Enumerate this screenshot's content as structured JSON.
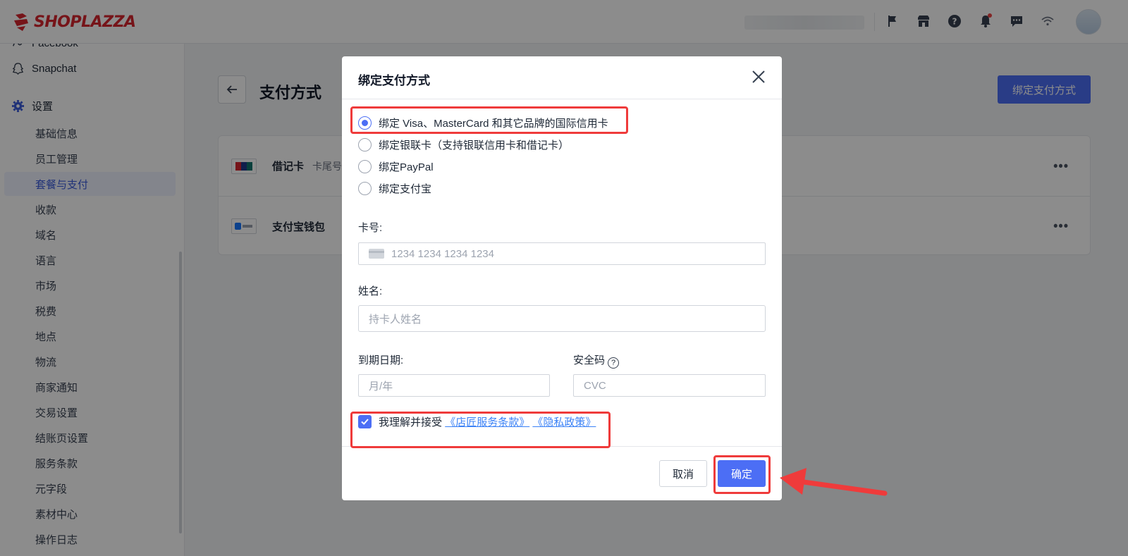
{
  "brand": {
    "name": "SHOPLAZZA",
    "color": "#d8262f"
  },
  "topbar": {
    "icons": [
      "flag-icon",
      "store-icon",
      "help-icon",
      "bell-icon",
      "chat-icon",
      "wifi-icon"
    ]
  },
  "sidebar": {
    "top_items": [
      {
        "label": "Facebook",
        "icon": "facebook-icon"
      },
      {
        "label": "Snapchat",
        "icon": "snapchat-icon"
      }
    ],
    "settings": {
      "label": "设置",
      "icon": "gear-icon"
    },
    "items": [
      {
        "label": "基础信息"
      },
      {
        "label": "员工管理"
      },
      {
        "label": "套餐与支付",
        "active": true
      },
      {
        "label": "收款"
      },
      {
        "label": "域名"
      },
      {
        "label": "语言"
      },
      {
        "label": "市场"
      },
      {
        "label": "税费"
      },
      {
        "label": "地点"
      },
      {
        "label": "物流"
      },
      {
        "label": "商家通知"
      },
      {
        "label": "交易设置"
      },
      {
        "label": "结账页设置"
      },
      {
        "label": "服务条款"
      },
      {
        "label": "元字段"
      },
      {
        "label": "素材中心"
      },
      {
        "label": "操作日志"
      }
    ]
  },
  "main": {
    "title": "支付方式",
    "bind_button": "绑定支付方式",
    "methods": [
      {
        "name": "借记卡",
        "sub": "卡尾号",
        "icon": "unionpay-icon"
      },
      {
        "name": "支付宝钱包",
        "sub": "",
        "icon": "alipay-icon"
      }
    ]
  },
  "modal": {
    "title": "绑定支付方式",
    "options": [
      {
        "label": "绑定 Visa、MasterCard 和其它品牌的国际信用卡",
        "checked": true
      },
      {
        "label": "绑定银联卡（支持银联信用卡和借记卡）",
        "checked": false
      },
      {
        "label": "绑定PayPal",
        "checked": false
      },
      {
        "label": "绑定支付宝",
        "checked": false
      }
    ],
    "card_number": {
      "label": "卡号:",
      "placeholder": "1234 1234 1234 1234"
    },
    "name": {
      "label": "姓名:",
      "placeholder": "持卡人姓名"
    },
    "expiry": {
      "label": "到期日期:",
      "placeholder": "月/年"
    },
    "cvc": {
      "label": "安全码",
      "placeholder": "CVC"
    },
    "agree": {
      "text": "我理解并接受",
      "terms_link": "《店匠服务条款》",
      "privacy_link": "《隐私政策》",
      "checked": true
    },
    "cancel": "取消",
    "confirm": "确定"
  },
  "colors": {
    "primary": "#4c6ef5",
    "annotation": "#ef3b3b",
    "link": "#3b82f6"
  }
}
